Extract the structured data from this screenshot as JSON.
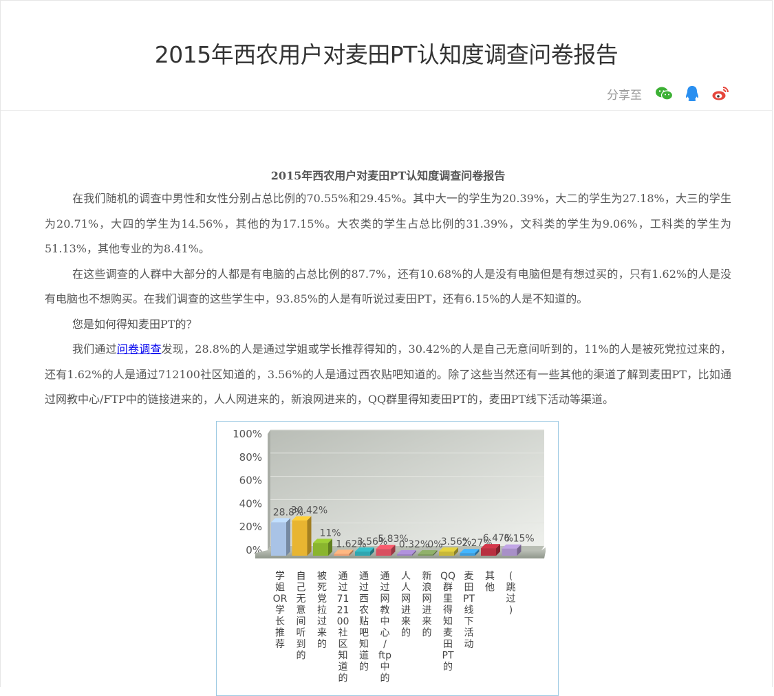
{
  "header": {
    "title": "2015年西农用户对麦田PT认知度调查问卷报告",
    "share_label": "分享至",
    "share_icons": [
      "wechat-icon",
      "qq-icon",
      "weibo-icon"
    ]
  },
  "article": {
    "title": "2015年西农用户对麦田PT认知度调查问卷报告",
    "p1": " 在我们随机的调查中男性和女性分别占总比例的70.55%和29.45%。其中大一的学生为20.39%，大二的学生为27.18%，大三的学生为20.71%，大四的学生为14.56%，其他的为17.15%。大农类的学生占总比例的31.39%，文科类的学生为9.06%，工科类的学生为51.13%，其他专业的为8.41%。",
    "p2": "在这些调查的人群中大部分的人都是有电脑的占总比例的87.7%，还有10.68%的人是没有电脑但是有想过买的，只有1.62%的人是没有电脑也不想购买。在我们调查的这些学生中，93.85%的人是有听说过麦田PT，还有6.15%的人是不知道的。",
    "p3": "您是如何得知麦田PT的？",
    "p4_before": "我们通过",
    "p4_link": "问卷调查",
    "p4_after": "发现，28.8%的人是通过学姐或学长推荐得知的，30.42%的人是自己无意间听到的，11%的人是被死党拉过来的，还有1.62%的人是通过712100社区知道的，3.56%的人是通过西农贴吧知道的。除了这些当然还有一些其他的渠道了解到麦田PT，比如通过网教中心/FTP中的链接进来的，人人网进来的，新浪网进来的，QQ群里得知麦田PT的，麦田PT线下活动等渠道。"
  },
  "chart_data": {
    "type": "bar",
    "ylim": [
      0,
      100
    ],
    "yticks": [
      "0%",
      "20%",
      "40%",
      "60%",
      "80%",
      "100%"
    ],
    "categories": [
      "学姐OR学长推荐",
      "自己无意间听到的",
      "被死党拉过来的",
      "通过712100社区知道的",
      "通过西农贴吧知道的",
      "通过网教中心/ftp中的",
      "人人网进来的",
      "新浪网进来的",
      "QQ群里得知麦田PT的",
      "麦田PT线下活动",
      "其他",
      "(跳过)"
    ],
    "values": [
      28.8,
      30.42,
      11,
      1.62,
      3.56,
      5.83,
      0.32,
      0,
      3.56,
      2.27,
      6.47,
      6.15
    ],
    "value_labels": [
      "28.8%",
      "30.42%",
      "11%",
      "1.62%",
      "3.56%",
      "5.83%",
      "0.32%",
      "0%",
      "3.56%",
      "2.27%",
      "6.47%",
      "6.15%"
    ],
    "colors": [
      "#a9c3e6",
      "#e8b531",
      "#8ab52e",
      "#f0a070",
      "#2fa6b0",
      "#d95060",
      "#9a7fc0",
      "#7d9a5c",
      "#c8b838",
      "#3a9ee0",
      "#b83040",
      "#a890c8"
    ]
  }
}
